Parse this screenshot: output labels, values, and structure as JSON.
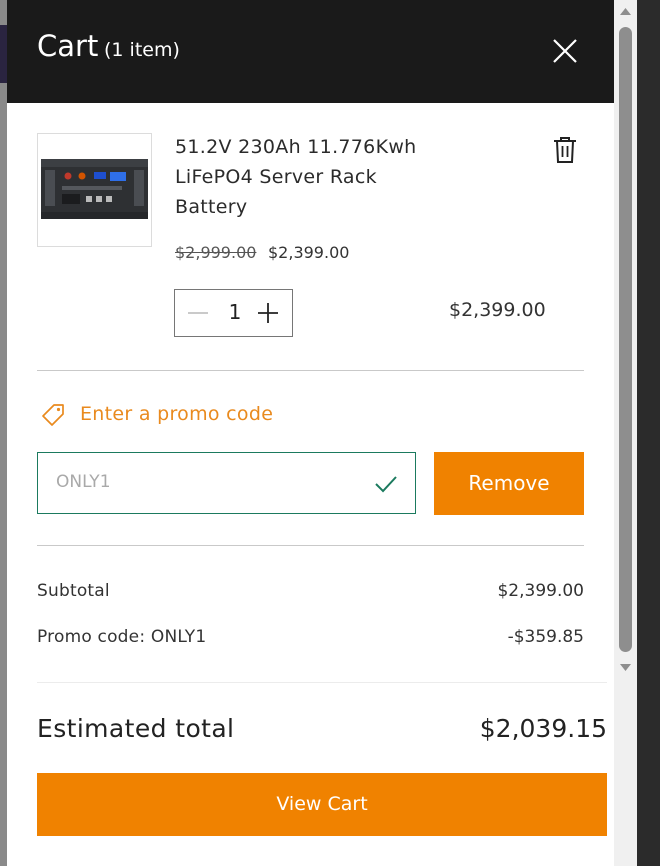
{
  "cart": {
    "title": "Cart",
    "count_label": "(1 item)"
  },
  "item": {
    "name": "51.2V 230Ah 11.776Kwh LiFePO4 Server Rack Battery",
    "original_price": "$2,999.00",
    "sale_price": "$2,399.00",
    "quantity": "1",
    "line_total": "$2,399.00"
  },
  "promo": {
    "link_label": "Enter a promo code",
    "code_value": "ONLY1",
    "remove_label": "Remove"
  },
  "summary": {
    "subtotal_label": "Subtotal",
    "subtotal_value": "$2,399.00",
    "promo_label": "Promo code: ONLY1",
    "promo_value": "-$359.85",
    "total_label": "Estimated total",
    "total_value": "$2,039.15"
  },
  "actions": {
    "view_cart_label": "View Cart"
  },
  "colors": {
    "accent": "#f08200",
    "header_bg": "#1a1a1a",
    "promo_text": "#e98a1e",
    "valid_border": "#1b7a5e"
  },
  "icons": [
    "close-icon",
    "trash-icon",
    "minus-icon",
    "plus-icon",
    "tag-icon",
    "check-icon"
  ]
}
